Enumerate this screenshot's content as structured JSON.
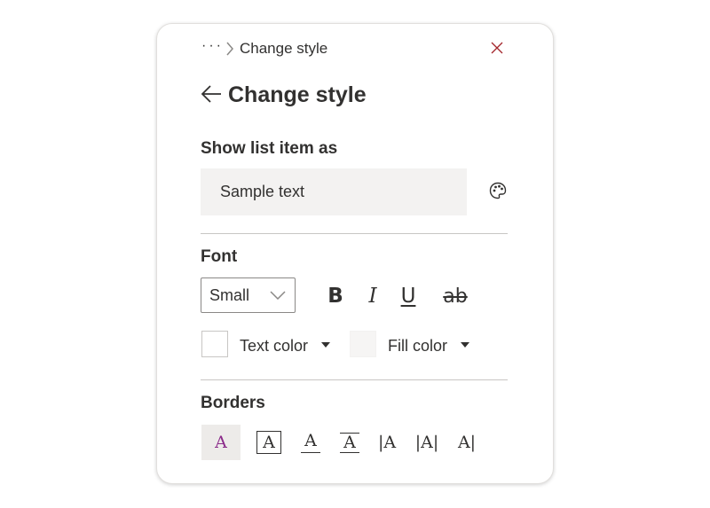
{
  "breadcrumb": {
    "more": "···",
    "current": "Change style"
  },
  "header": {
    "title": "Change style"
  },
  "show_as": {
    "label": "Show list item as",
    "sample_text": "Sample text"
  },
  "font": {
    "label": "Font",
    "size_value": "Small",
    "bold": "B",
    "italic": "I",
    "underline": "U",
    "strikethrough": "ab",
    "text_color_label": "Text color",
    "fill_color_label": "Fill color"
  },
  "borders": {
    "label": "Borders",
    "options": [
      {
        "glyph": "A",
        "name": "none"
      },
      {
        "glyph": "A",
        "name": "all"
      },
      {
        "glyph": "A",
        "name": "bottom"
      },
      {
        "glyph": "A",
        "name": "top-bottom"
      },
      {
        "glyph": "|A",
        "name": "left"
      },
      {
        "glyph": "|A|",
        "name": "left-right"
      },
      {
        "glyph": "A|",
        "name": "right"
      }
    ]
  },
  "colors": {
    "accent": "#8b2c8a",
    "close_icon": "#a4262c",
    "text": "#323130",
    "divider": "#c8c6c4",
    "sample_bg": "#f3f2f1"
  },
  "icons": [
    "more-icon",
    "chevron-right-icon",
    "close-icon",
    "back-arrow-icon",
    "palette-icon",
    "chevron-down-icon",
    "caret-down-icon"
  ]
}
